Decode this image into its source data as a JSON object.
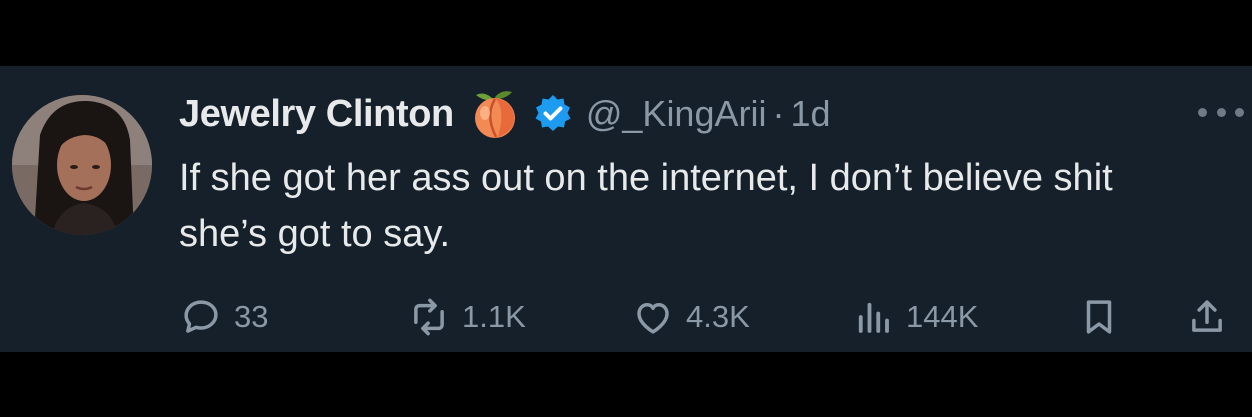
{
  "tweet": {
    "author": {
      "display_name": "Jewelry Clinton",
      "handle": "@_KingArii",
      "emoji": "peach",
      "verified": true
    },
    "separator": "·",
    "time": "1d",
    "text": "If she got her ass out on the internet, I don’t believe shit she’s got to say.",
    "actions": {
      "replies": "33",
      "reposts": "1.1K",
      "likes": "4.3K",
      "views": "144K"
    }
  },
  "colors": {
    "background": "#15202b",
    "primary_text": "#e7e9ea",
    "secondary_text": "#8b98a5",
    "verified_badge": "#1d9bf0"
  },
  "icons": [
    "more-icon",
    "reply-icon",
    "repost-icon",
    "like-icon",
    "views-icon",
    "bookmark-icon",
    "share-icon"
  ]
}
